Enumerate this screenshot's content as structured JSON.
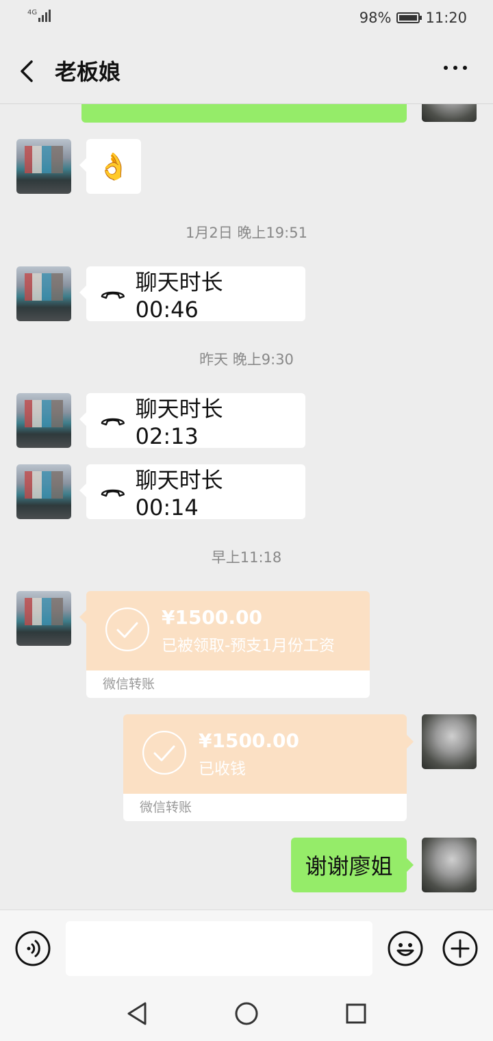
{
  "status": {
    "network": "4G",
    "battery": "98%",
    "battery_level": 0.98,
    "time": "11:20"
  },
  "header": {
    "title": "老板娘"
  },
  "chat": {
    "messages": [
      {
        "type": "emoji",
        "side": "left",
        "content": "👌"
      },
      {
        "type": "timestamp",
        "text": "1月2日 晚上19:51"
      },
      {
        "type": "call",
        "side": "left",
        "text": "聊天时长 00:46"
      },
      {
        "type": "timestamp",
        "text": "昨天 晚上9:30"
      },
      {
        "type": "call",
        "side": "left",
        "text": "聊天时长 02:13"
      },
      {
        "type": "call",
        "side": "left",
        "text": "聊天时长 00:14"
      },
      {
        "type": "timestamp",
        "text": "早上11:18"
      },
      {
        "type": "transfer",
        "side": "left",
        "amount": "¥1500.00",
        "desc": "已被领取-预支1月份工资",
        "footer": "微信转账"
      },
      {
        "type": "transfer",
        "side": "right",
        "amount": "¥1500.00",
        "desc": "已收钱",
        "footer": "微信转账"
      },
      {
        "type": "text",
        "side": "right",
        "text": "谢谢廖姐"
      }
    ]
  },
  "colors": {
    "green_bubble": "#95ec69",
    "transfer_bg": "#fbe0c4",
    "background": "#ededed"
  },
  "icons": [
    "back-arrow-icon",
    "more-icon",
    "hangup-icon",
    "check-circle-icon",
    "voice-icon",
    "emoji-icon",
    "plus-icon",
    "nav-back-icon",
    "nav-home-icon",
    "nav-recents-icon"
  ]
}
